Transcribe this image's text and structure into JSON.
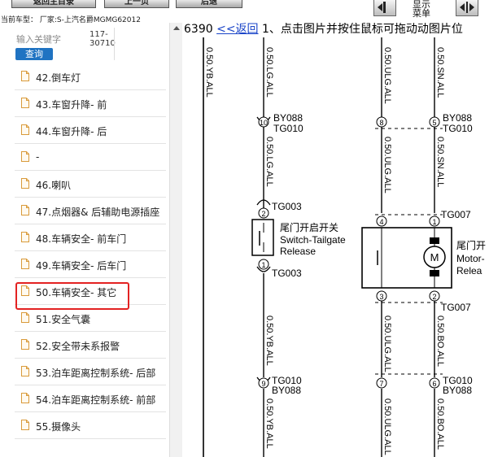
{
  "toolbar": {
    "btn1": "返回主目录",
    "btn2": "上一页",
    "btn3": "后退",
    "menu_label": "显示菜单",
    "current_car": "当前车型： 厂家:S-上汽名爵MGMG62012"
  },
  "left": {
    "search_placeholder": "输入关键字",
    "search_button": "查询",
    "code": "117-30710",
    "items": [
      "42.倒车灯",
      "43.车窗升降- 前",
      "44.车窗升降- 后",
      "-",
      "46.喇叭",
      "47.点烟器& 后辅助电源插座",
      "48.车辆安全- 前车门",
      "49.车辆安全- 后车门",
      "50.车辆安全- 其它",
      "51.安全气囊",
      "52.安全带未系报警",
      "53.泊车距离控制系统- 后部",
      "54.泊车距离控制系统- 前部",
      "55.摄像头"
    ],
    "selected_index": 8
  },
  "diagram": {
    "page_no": "6390",
    "back_link": "<<返回",
    "instruction": "1、点击图片并按住鼠标可拖动动图片位",
    "wire_labels": [
      "0.50.YB.ALL",
      "0.50.LG.ALL",
      "0.50.ULG.ALL",
      "0.50.SN.ALL",
      "0.50.LG.ALL",
      "0.50.ULG.ALL",
      "0.50.SN.ALL",
      "0.50.YB.ALL",
      "0.50.ULG.ALL",
      "0.50.BO.ALL",
      "0.50.YB.ALL",
      "0.50.ULG.ALL",
      "0.50.BO.ALL"
    ],
    "pin_labels": [
      "10",
      "8",
      "5",
      "2",
      "4",
      "1",
      "1",
      "3",
      "2",
      "9",
      "7",
      "6"
    ],
    "connector_labels": {
      "by088_top": "BY088",
      "tg010_top": "TG010",
      "by088_top_r": "BY088",
      "tg010_top_r": "TG010",
      "tg003_a": "TG003",
      "tg007_a": "TG007",
      "tg003_b": "TG003",
      "tg007_b": "TG007",
      "tg010_bot": "TG010",
      "by088_bot": "BY088",
      "tg010_bot_r": "TG010",
      "by088_bot_r": "BY088"
    },
    "switch_cn": "尾门开启开关",
    "switch_en1": "Switch-Tailgate",
    "switch_en2": "Release",
    "motor_letter": "M",
    "motor_cn": "尾门开",
    "motor_en1": "Motor-",
    "motor_en2": "Relea"
  },
  "colors": {
    "highlight": "#e32222",
    "link": "#1a44c8",
    "search_button": "#1f73c2"
  }
}
